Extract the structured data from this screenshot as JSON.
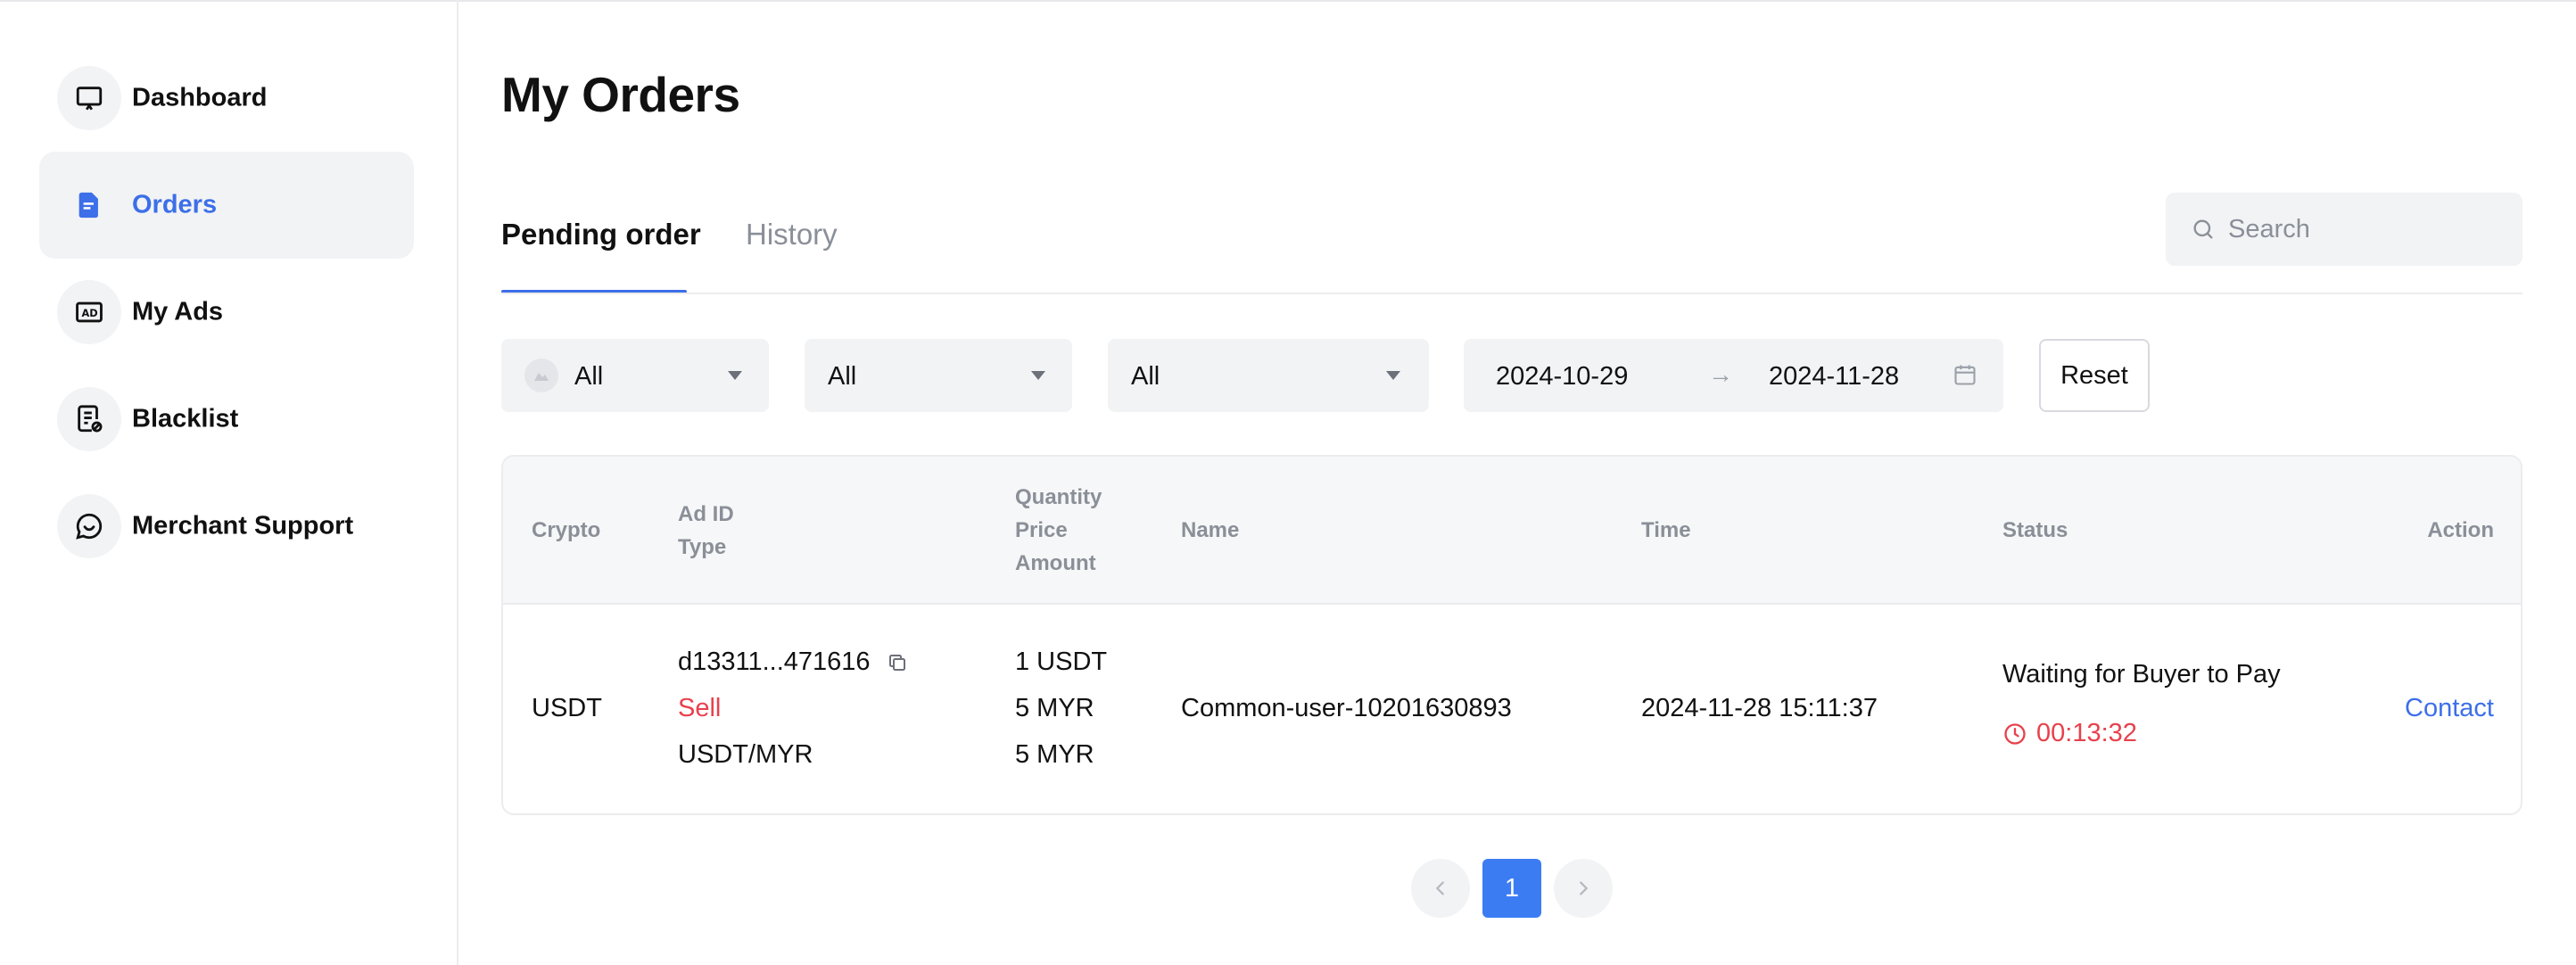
{
  "sidebar": {
    "items": [
      {
        "label": "Dashboard",
        "icon": "monitor-icon",
        "active": false
      },
      {
        "label": "Orders",
        "icon": "document-icon",
        "active": true
      },
      {
        "label": "My Ads",
        "icon": "ad-icon",
        "active": false
      },
      {
        "label": "Blacklist",
        "icon": "blacklist-icon",
        "active": false
      },
      {
        "label": "Merchant Support",
        "icon": "chat-icon",
        "active": false
      }
    ]
  },
  "page": {
    "title": "My Orders"
  },
  "tabs": [
    {
      "label": "Pending order",
      "active": true
    },
    {
      "label": "History",
      "active": false
    }
  ],
  "search": {
    "placeholder": "Search"
  },
  "filters": {
    "crypto": {
      "value": "All",
      "icon": "coin-icon"
    },
    "type": {
      "value": "All"
    },
    "status": {
      "value": "All"
    },
    "date_start": "2024-10-29",
    "date_end": "2024-11-28",
    "reset_label": "Reset"
  },
  "table": {
    "headers": {
      "crypto": "Crypto",
      "ad_id": "Ad ID",
      "type": "Type",
      "quantity": "Quantity",
      "price": "Price",
      "amount": "Amount",
      "name": "Name",
      "time": "Time",
      "status": "Status",
      "action": "Action"
    },
    "rows": [
      {
        "crypto": "USDT",
        "ad_id": "d13311...471616",
        "type": "Sell",
        "pair": "USDT/MYR",
        "quantity": "1 USDT",
        "price": "5 MYR",
        "amount": "5 MYR",
        "name": "Common-user-10201630893",
        "time": "2024-11-28 15:11:37",
        "status": "Waiting for Buyer to Pay",
        "countdown": "00:13:32",
        "action": "Contact"
      }
    ]
  },
  "pagination": {
    "current": "1"
  },
  "colors": {
    "accent": "#3c6fe8",
    "danger": "#e8414d",
    "muted": "#8a8f98"
  }
}
